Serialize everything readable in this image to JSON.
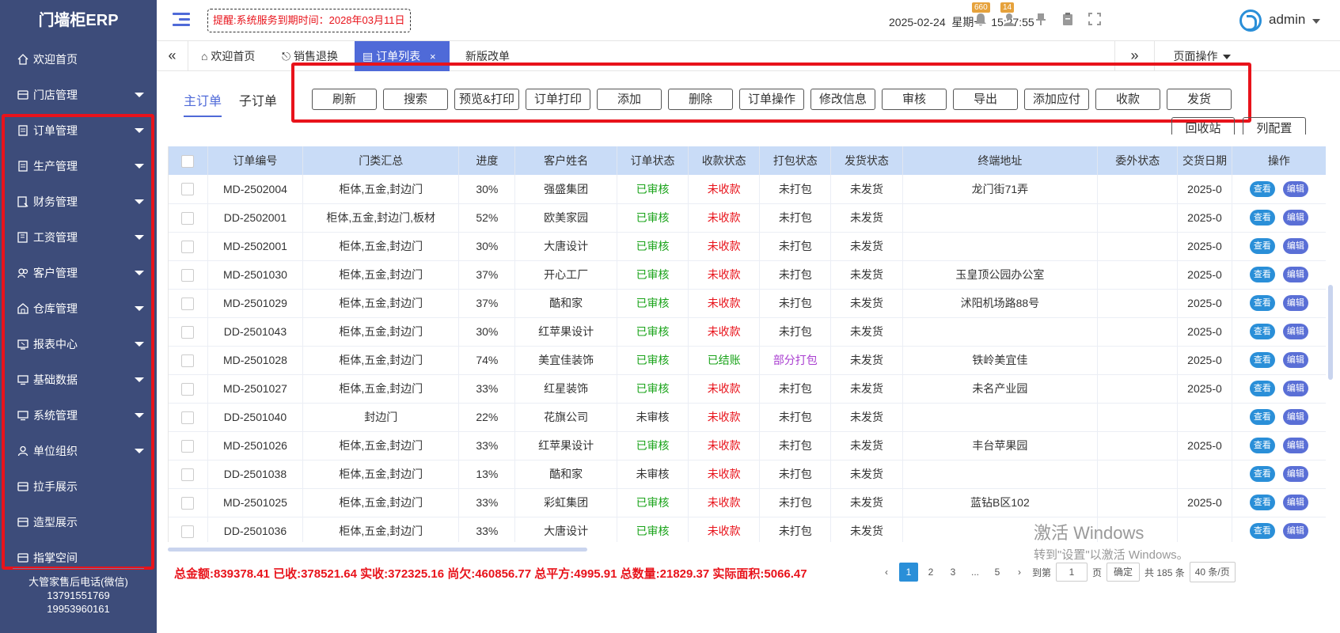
{
  "app": {
    "title": "门墙柜ERP"
  },
  "sidebar": {
    "items": [
      {
        "label": "欢迎首页",
        "icon": "home-icon",
        "caret": false
      },
      {
        "label": "门店管理",
        "icon": "store-icon",
        "caret": true
      },
      {
        "label": "订单管理",
        "icon": "document-icon",
        "caret": true
      },
      {
        "label": "生产管理",
        "icon": "document-icon",
        "caret": true
      },
      {
        "label": "财务管理",
        "icon": "finance-icon",
        "caret": true
      },
      {
        "label": "工资管理",
        "icon": "salary-icon",
        "caret": true
      },
      {
        "label": "客户管理",
        "icon": "users-icon",
        "caret": true
      },
      {
        "label": "仓库管理",
        "icon": "warehouse-icon",
        "caret": true
      },
      {
        "label": "报表中心",
        "icon": "report-icon",
        "caret": true
      },
      {
        "label": "基础数据",
        "icon": "monitor-icon",
        "caret": true
      },
      {
        "label": "系统管理",
        "icon": "monitor-icon",
        "caret": true
      },
      {
        "label": "单位组织",
        "icon": "user-icon",
        "caret": true
      },
      {
        "label": "拉手展示",
        "icon": "store-icon",
        "caret": false
      },
      {
        "label": "造型展示",
        "icon": "store-icon",
        "caret": false
      },
      {
        "label": "指掌空间",
        "icon": "store-icon",
        "caret": false
      }
    ],
    "footer": {
      "line1": "大管家售后电话(微信)",
      "line2": "13791551769",
      "line3": "19953960161"
    }
  },
  "header": {
    "notice": "提醒:系统服务到期时间：2028年03月11日",
    "date": "2025-02-24",
    "weekday": "星期一",
    "time": "15:27:55",
    "bell_count": "660",
    "user_count": "14",
    "username": "admin"
  },
  "tabs": {
    "items": [
      {
        "label": "欢迎首页",
        "icon": "home-icon",
        "active": false
      },
      {
        "label": "销售退换",
        "icon": "return-icon",
        "active": false
      },
      {
        "label": "订单列表",
        "icon": "document-icon",
        "active": true
      },
      {
        "label": "新版改单",
        "icon": "",
        "active": false
      }
    ],
    "close_glyph": "×",
    "nav_left": "«",
    "nav_right": "»",
    "page_ops": "页面操作"
  },
  "subtabs": {
    "main": "主订单",
    "sub": "子订单"
  },
  "toolbar": {
    "buttons": [
      "刷新",
      "搜索",
      "预览&打印",
      "订单打印",
      "添加",
      "删除",
      "订单操作",
      "修改信息",
      "审核",
      "导出",
      "添加应付",
      "收款",
      "发货"
    ],
    "extra": [
      "回收站",
      "列配置"
    ]
  },
  "table": {
    "columns": [
      "订单编号",
      "门类汇总",
      "进度",
      "客户姓名",
      "订单状态",
      "收款状态",
      "打包状态",
      "发货状态",
      "终端地址",
      "委外状态",
      "交货日期",
      "操作"
    ],
    "view_label": "查看",
    "edit_label": "编辑",
    "rows": [
      {
        "id": "MD-2502004",
        "cat": "柜体,五金,封边门",
        "progress": "30%",
        "customer": "强盛集团",
        "order": "已审核",
        "pay": "未收款",
        "pack": "未打包",
        "ship": "未发货",
        "addr": "龙门街71弄",
        "out": "",
        "date": "2025-0"
      },
      {
        "id": "DD-2502001",
        "cat": "柜体,五金,封边门,板材",
        "progress": "52%",
        "customer": "欧美家园",
        "order": "已审核",
        "pay": "未收款",
        "pack": "未打包",
        "ship": "未发货",
        "addr": "",
        "out": "",
        "date": "2025-0"
      },
      {
        "id": "MD-2502001",
        "cat": "柜体,五金,封边门",
        "progress": "30%",
        "customer": "大唐设计",
        "order": "已审核",
        "pay": "未收款",
        "pack": "未打包",
        "ship": "未发货",
        "addr": "",
        "out": "",
        "date": "2025-0"
      },
      {
        "id": "MD-2501030",
        "cat": "柜体,五金,封边门",
        "progress": "37%",
        "customer": "开心工厂",
        "order": "已审核",
        "pay": "未收款",
        "pack": "未打包",
        "ship": "未发货",
        "addr": "玉皇顶公园办公室",
        "out": "",
        "date": "2025-0"
      },
      {
        "id": "MD-2501029",
        "cat": "柜体,五金,封边门",
        "progress": "37%",
        "customer": "酷和家",
        "order": "已审核",
        "pay": "未收款",
        "pack": "未打包",
        "ship": "未发货",
        "addr": "沭阳机场路88号",
        "out": "",
        "date": "2025-0"
      },
      {
        "id": "DD-2501043",
        "cat": "柜体,五金,封边门",
        "progress": "30%",
        "customer": "红苹果设计",
        "order": "已审核",
        "pay": "未收款",
        "pack": "未打包",
        "ship": "未发货",
        "addr": "",
        "out": "",
        "date": "2025-0"
      },
      {
        "id": "MD-2501028",
        "cat": "柜体,五金,封边门",
        "progress": "74%",
        "customer": "美宜佳装饰",
        "order": "已审核",
        "pay": "已结账",
        "pack": "部分打包",
        "ship": "未发货",
        "addr": "铁岭美宜佳",
        "out": "",
        "date": "2025-0"
      },
      {
        "id": "MD-2501027",
        "cat": "柜体,五金,封边门",
        "progress": "33%",
        "customer": "红星装饰",
        "order": "已审核",
        "pay": "未收款",
        "pack": "未打包",
        "ship": "未发货",
        "addr": "未名产业园",
        "out": "",
        "date": "2025-0"
      },
      {
        "id": "DD-2501040",
        "cat": "封边门",
        "progress": "22%",
        "customer": "花旗公司",
        "order": "未审核",
        "pay": "未收款",
        "pack": "未打包",
        "ship": "未发货",
        "addr": "",
        "out": "",
        "date": ""
      },
      {
        "id": "MD-2501026",
        "cat": "柜体,五金,封边门",
        "progress": "33%",
        "customer": "红苹果设计",
        "order": "已审核",
        "pay": "未收款",
        "pack": "未打包",
        "ship": "未发货",
        "addr": "丰台苹果园",
        "out": "",
        "date": "2025-0"
      },
      {
        "id": "DD-2501038",
        "cat": "柜体,五金,封边门",
        "progress": "13%",
        "customer": "酷和家",
        "order": "未审核",
        "pay": "未收款",
        "pack": "未打包",
        "ship": "未发货",
        "addr": "",
        "out": "",
        "date": ""
      },
      {
        "id": "MD-2501025",
        "cat": "柜体,五金,封边门",
        "progress": "33%",
        "customer": "彩虹集团",
        "order": "已审核",
        "pay": "未收款",
        "pack": "未打包",
        "ship": "未发货",
        "addr": "蓝钻B区102",
        "out": "",
        "date": "2025-0"
      },
      {
        "id": "DD-2501036",
        "cat": "柜体,五金,封边门",
        "progress": "33%",
        "customer": "大唐设计",
        "order": "已审核",
        "pay": "未收款",
        "pack": "未打包",
        "ship": "未发货",
        "addr": "",
        "out": "",
        "date": ""
      }
    ]
  },
  "footer": {
    "totals": "总金额:839378.41 已收:378521.64 实收:372325.16 尚欠:460856.77 总平方:4995.91 总数量:21829.37 实际面积:5066.47",
    "pages": [
      "1",
      "2",
      "3",
      "...",
      "5"
    ],
    "current_page": "1",
    "goto_label": "到第",
    "goto_value": "1",
    "page_unit": "页",
    "confirm": "确定",
    "total": "共 185 条",
    "page_size": "40 条/页",
    "prev_glyph": "‹",
    "next_glyph": "›"
  },
  "watermark": {
    "line1": "激活 Windows",
    "line2": "转到\"设置\"以激活 Windows。"
  },
  "colors": {
    "sidebar": "#3d4c7a",
    "accent": "#4f6ad8",
    "highlight": "#e8131b",
    "approved": "#19a319",
    "unpaid": "#e8131b",
    "partial": "#a93ed0"
  }
}
